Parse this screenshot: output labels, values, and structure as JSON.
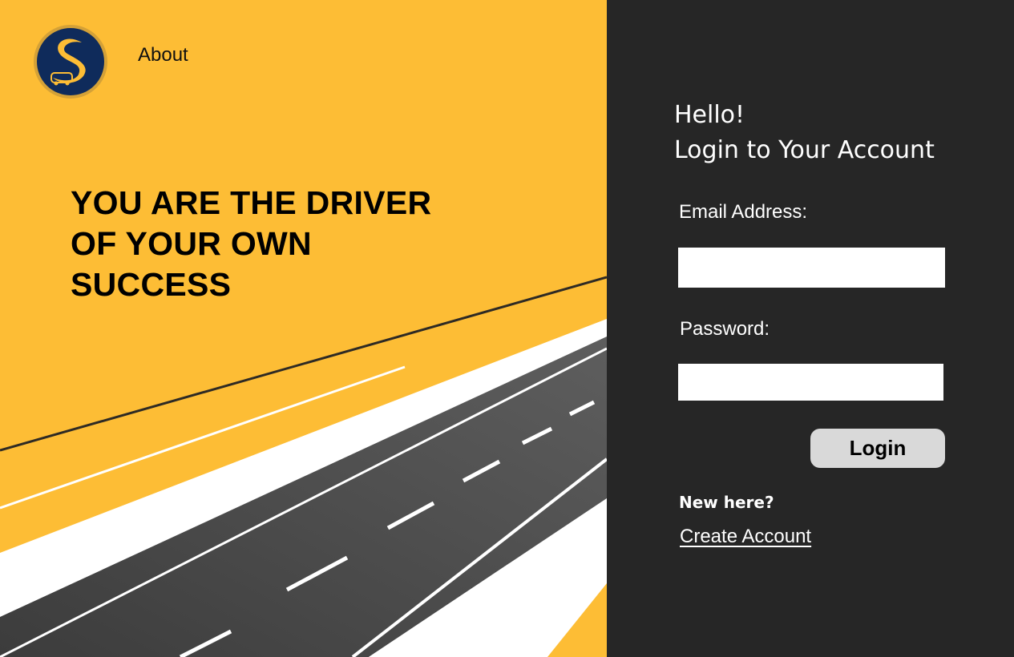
{
  "nav": {
    "about_label": "About"
  },
  "logo": {
    "icon": "s-road-car-logo-icon",
    "ring_color": "#d4a137",
    "bg_color": "#0f2b5b",
    "accent_color": "#fdbd35"
  },
  "hero": {
    "line1": "YOU ARE THE DRIVER",
    "line2": "OF YOUR OWN",
    "line3": "SUCCESS"
  },
  "login": {
    "greeting": "Hello!",
    "heading": "Login to Your Account",
    "email_label": "Email Address:",
    "email_value": "",
    "password_label": "Password:",
    "password_value": "",
    "button_label": "Login",
    "new_here": "New here?",
    "create_account": "Create Account"
  },
  "colors": {
    "yellow": "#fdbd35",
    "dark": "#262626",
    "asphalt": "#4a4a4a",
    "button": "#d9d9d9"
  }
}
